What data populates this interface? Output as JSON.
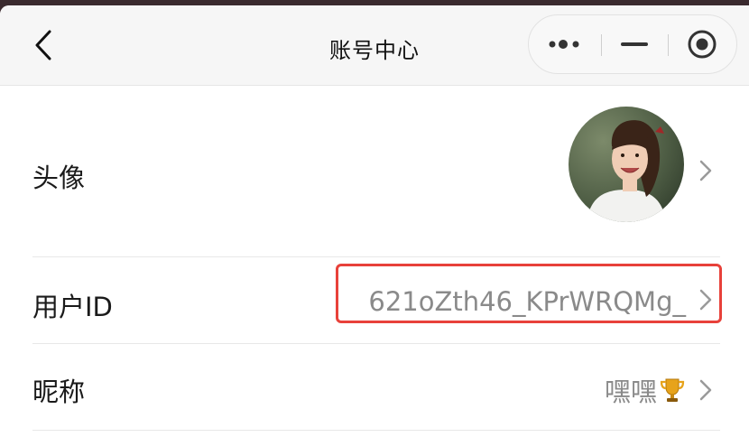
{
  "nav": {
    "title": "账号中心"
  },
  "rows": {
    "avatar": {
      "label": "头像"
    },
    "user_id": {
      "label": "用户ID",
      "value": "621oZth46_KPrWRQMg_"
    },
    "nickname": {
      "label": "昵称",
      "value": "嘿嘿",
      "emoji_icon": "trophy-icon"
    }
  },
  "colors": {
    "highlight": "#e8413a",
    "value_text": "#8a8a8a",
    "label_text": "#1a1a1a"
  }
}
